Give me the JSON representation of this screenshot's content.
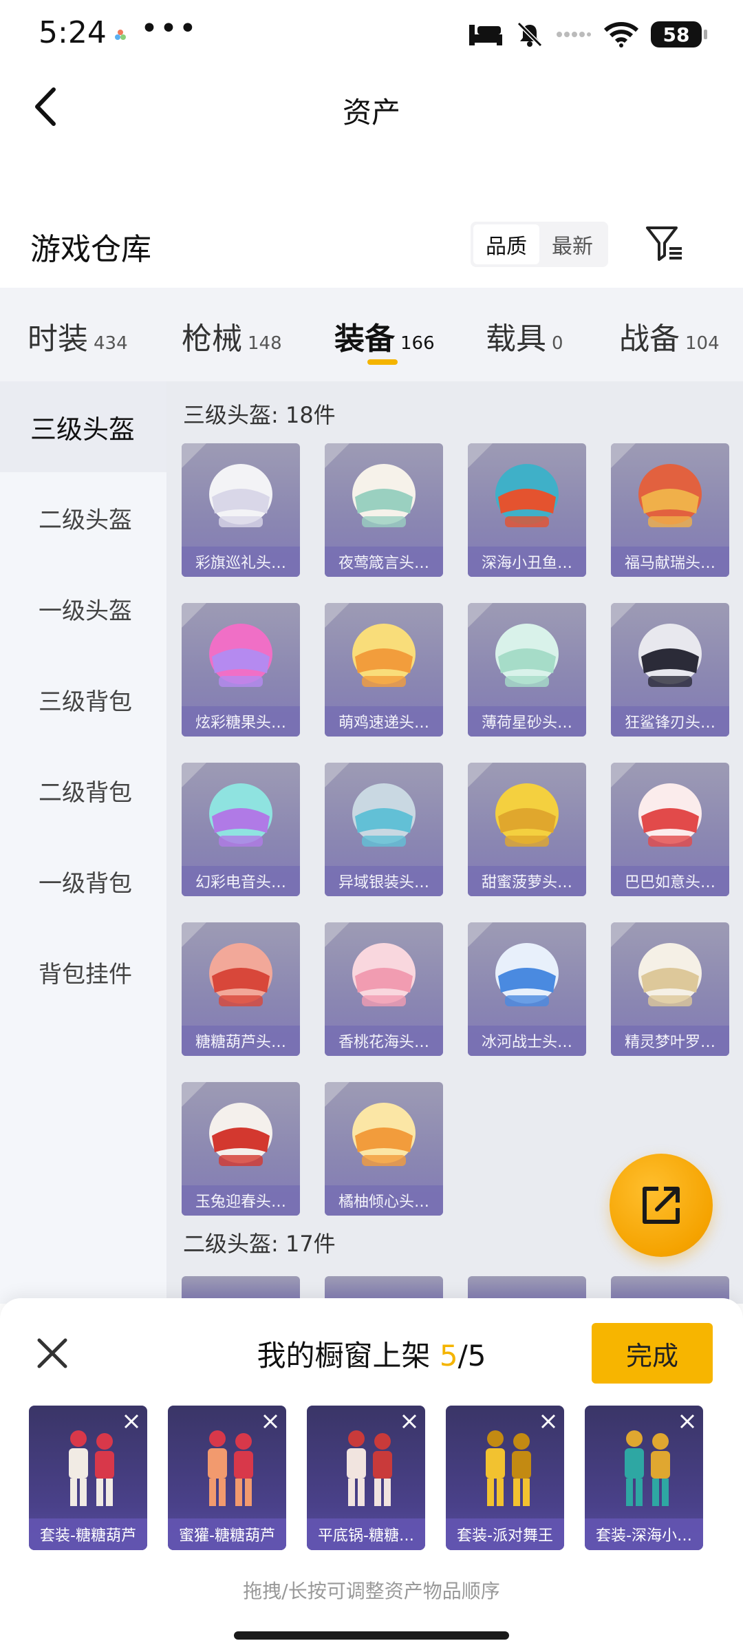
{
  "status_bar": {
    "time": "5:24",
    "more": "•••",
    "battery": "58"
  },
  "nav": {
    "title": "资产"
  },
  "warehouse": {
    "title": "游戏仓库",
    "sort_options": [
      {
        "label": "品质",
        "active": true
      },
      {
        "label": "最新",
        "active": false
      }
    ]
  },
  "category_tabs": [
    {
      "label": "时装",
      "count": "434"
    },
    {
      "label": "枪械",
      "count": "148"
    },
    {
      "label": "装备",
      "count": "166",
      "active": true
    },
    {
      "label": "载具",
      "count": "0"
    },
    {
      "label": "战备",
      "count": "104"
    }
  ],
  "sidebar": {
    "items": [
      {
        "label": "三级头盔",
        "active": true
      },
      {
        "label": "二级头盔"
      },
      {
        "label": "一级头盔"
      },
      {
        "label": "三级背包"
      },
      {
        "label": "二级背包"
      },
      {
        "label": "一级背包"
      },
      {
        "label": "背包挂件"
      }
    ]
  },
  "sections": [
    {
      "title": "三级头盔: 18件",
      "items": [
        {
          "name": "彩旗巡礼头…",
          "colors": [
            "#f3f3f6",
            "#d9d7e8"
          ]
        },
        {
          "name": "夜莺箴言头…",
          "colors": [
            "#f6f2ea",
            "#9ad0c0"
          ]
        },
        {
          "name": "深海小丑鱼…",
          "colors": [
            "#3fb0c8",
            "#e4532f"
          ]
        },
        {
          "name": "福马献瑞头…",
          "colors": [
            "#e2613f",
            "#f0b04a"
          ]
        },
        {
          "name": "炫彩糖果头…",
          "colors": [
            "#f06fc6",
            "#b58af0"
          ]
        },
        {
          "name": "萌鸡速递头…",
          "colors": [
            "#f9dd7a",
            "#f29d3c"
          ]
        },
        {
          "name": "薄荷星砂头…",
          "colors": [
            "#d9f2ea",
            "#a6dcc8"
          ]
        },
        {
          "name": "狂鲨锋刃头…",
          "colors": [
            "#e8e8ee",
            "#2b2b38"
          ]
        },
        {
          "name": "幻彩电音头…",
          "colors": [
            "#8fe3e0",
            "#b07ae6"
          ]
        },
        {
          "name": "异域银装头…",
          "colors": [
            "#c9d8e2",
            "#62c0d6"
          ]
        },
        {
          "name": "甜蜜菠萝头…",
          "colors": [
            "#f4d03f",
            "#e0a72d"
          ]
        },
        {
          "name": "巴巴如意头…",
          "colors": [
            "#fbecec",
            "#e24a4a"
          ]
        },
        {
          "name": "糖糖葫芦头…",
          "colors": [
            "#f2a899",
            "#d8473a"
          ]
        },
        {
          "name": "香桃花海头…",
          "colors": [
            "#f9d7de",
            "#f19cb1"
          ]
        },
        {
          "name": "冰河战士头…",
          "colors": [
            "#e8f0fb",
            "#4a8ae0"
          ]
        },
        {
          "name": "精灵梦叶罗…",
          "colors": [
            "#f5f0e6",
            "#ddc89a"
          ]
        },
        {
          "name": "玉兔迎春头…",
          "colors": [
            "#f4f0ec",
            "#d3382f"
          ]
        },
        {
          "name": "橘柚倾心头…",
          "colors": [
            "#fbe6a5",
            "#f29c3c"
          ]
        }
      ]
    },
    {
      "title": "二级头盔: 17件"
    }
  ],
  "shelf": {
    "title_prefix": "我的橱窗上架",
    "current": "5",
    "total": "/5",
    "done_label": "完成",
    "hint": "拖拽/长按可调整资产物品顺序",
    "items": [
      {
        "name": "套装-糖糖葫芦",
        "colors": [
          "#f1ebe4",
          "#d8384a"
        ]
      },
      {
        "name": "蜜獾-糖糖葫芦",
        "colors": [
          "#f29a6e",
          "#d8384a"
        ]
      },
      {
        "name": "平底锅-糖糖…",
        "colors": [
          "#f1e4df",
          "#c93a3a"
        ]
      },
      {
        "name": "套装-派对舞王",
        "colors": [
          "#f2c230",
          "#c38a12"
        ]
      },
      {
        "name": "套装-深海小…",
        "colors": [
          "#2ea7a3",
          "#e0a730"
        ]
      }
    ]
  }
}
